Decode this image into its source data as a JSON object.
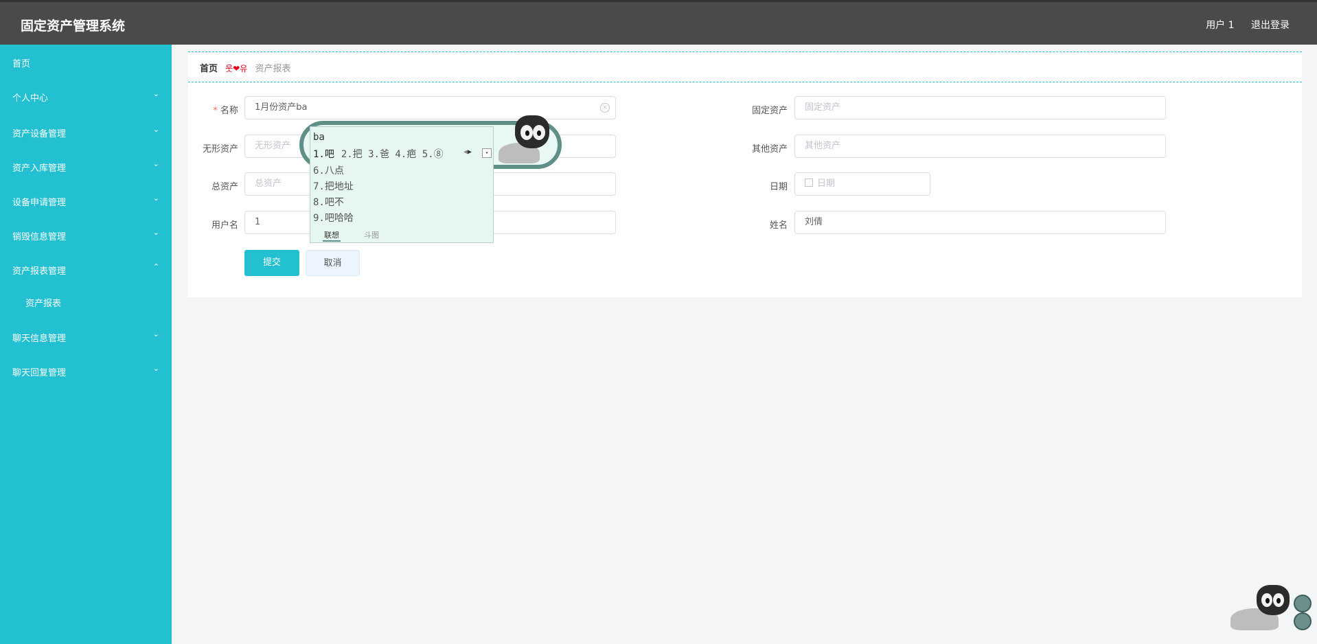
{
  "header": {
    "title": "固定资产管理系统",
    "user": "用户 1",
    "logout": "退出登录"
  },
  "sidebar": {
    "items": [
      {
        "label": "首页"
      },
      {
        "label": "个人中心",
        "chevron": "⌄"
      },
      {
        "label": "资产设备管理",
        "chevron": "⌄"
      },
      {
        "label": "资产入库管理",
        "chevron": "⌄"
      },
      {
        "label": "设备申请管理",
        "chevron": "⌄"
      },
      {
        "label": "销毁信息管理",
        "chevron": "⌄"
      },
      {
        "label": "资产报表管理",
        "chevron": "⌃"
      },
      {
        "label": "资产报表"
      },
      {
        "label": "聊天信息管理",
        "chevron": "⌄"
      },
      {
        "label": "聊天回复管理",
        "chevron": "⌄"
      }
    ]
  },
  "breadcrumb": {
    "home": "首页",
    "separator": "웃❤유",
    "current": "资产报表"
  },
  "form": {
    "name": {
      "label": "名称",
      "required_mark": "*",
      "value": "1月份资产ba"
    },
    "fixed_assets": {
      "label": "固定资产",
      "placeholder": "固定资产"
    },
    "intangible_assets": {
      "label": "无形资产",
      "placeholder": "无形资产"
    },
    "other_assets": {
      "label": "其他资产",
      "placeholder": "其他资产"
    },
    "total_assets": {
      "label": "总资产",
      "placeholder": "总资产"
    },
    "date": {
      "label": "日期",
      "placeholder": "日期"
    },
    "username": {
      "label": "用户名",
      "value": "1"
    },
    "realname": {
      "label": "姓名",
      "value": "刘倩"
    },
    "submit": "提交",
    "cancel": "取消"
  },
  "ime": {
    "typed": "ba",
    "first_candidate": "1.吧",
    "row_candidates": "2.把  3.爸  4.疤  5.⑧",
    "arrows_left": "◀",
    "arrows_right": "▶",
    "dropdown": "▾",
    "candidates": [
      "6.八点",
      "7.把地址",
      "8.吧不",
      "9.吧哈哈"
    ],
    "tab_active": "联想",
    "tab_inactive": "斗图"
  },
  "icons": {
    "clear": "clear-icon",
    "calendar": "calendar-icon",
    "chevron": "chevron-icon"
  },
  "colors": {
    "accent": "#23c0d2",
    "header": "#4a4a4a",
    "required": "#f56c6c"
  }
}
